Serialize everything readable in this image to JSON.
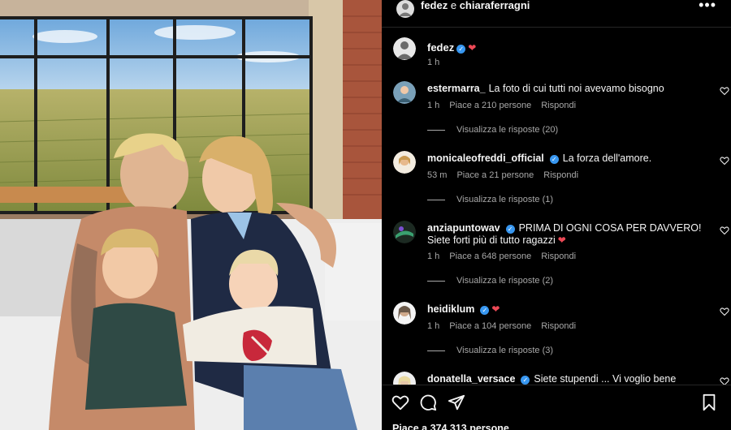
{
  "header": {
    "user_a": "fedez",
    "connector": " e ",
    "user_b": "chiaraferragni",
    "more_icon": "more-dots-icon"
  },
  "caption": {
    "username": "fedez",
    "time": "1 h"
  },
  "comments": [
    {
      "username": "estermarra_",
      "verified": false,
      "heart": false,
      "text": "La foto di cui tutti noi avevamo bisogno",
      "time": "1 h",
      "likes": "Piace a 210 persone",
      "reply": "Rispondi",
      "view_replies": "Visualizza le risposte (20)"
    },
    {
      "username": "monicaleofreddi_official",
      "verified": true,
      "heart": false,
      "text": "La forza dell'amore.",
      "time": "53 m",
      "likes": "Piace a 21 persone",
      "reply": "Rispondi",
      "view_replies": "Visualizza le risposte (1)"
    },
    {
      "username": "anziapuntowav",
      "verified": true,
      "heart": false,
      "text": "PRIMA DI OGNI COSA PER DAVVERO! Siete forti più di tutto ragazzi",
      "text_heart": true,
      "time": "1 h",
      "likes": "Piace a 648 persone",
      "reply": "Rispondi",
      "view_replies": "Visualizza le risposte (2)"
    },
    {
      "username": "heidiklum",
      "verified": true,
      "heart": true,
      "text": "",
      "time": "1 h",
      "likes": "Piace a 104 persone",
      "reply": "Rispondi",
      "view_replies": "Visualizza le risposte (3)"
    },
    {
      "username": "donatella_versace",
      "verified": true,
      "heart": false,
      "text": "Siete stupendi ... Vi voglio bene",
      "time": "",
      "likes": "",
      "reply": "",
      "view_replies": ""
    }
  ],
  "actions": {
    "like_icon": "heart-outline-icon",
    "comment_icon": "comment-icon",
    "share_icon": "send-icon",
    "save_icon": "bookmark-icon",
    "likes_text": "Piace a 374.313 persone"
  },
  "colors": {
    "background": "#000000",
    "text": "#f5f5f5",
    "secondary_text": "#a8a8a8",
    "verified": "#3897f0",
    "heart": "#ed4956",
    "divider": "#262626"
  }
}
